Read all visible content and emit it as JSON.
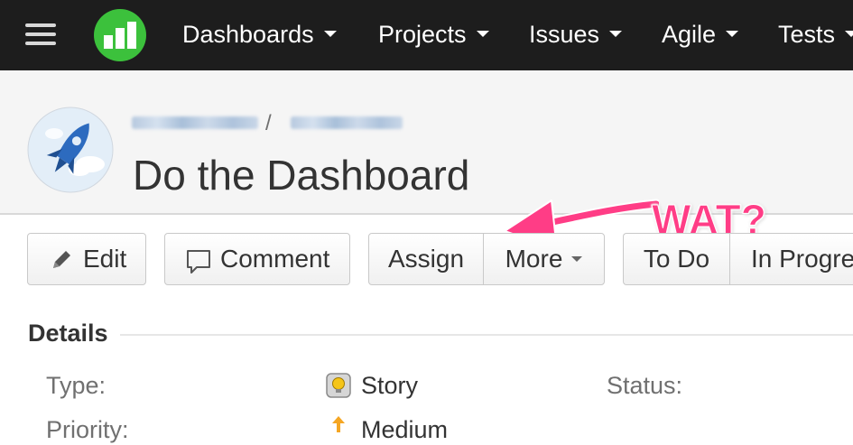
{
  "nav": {
    "items": [
      {
        "label": "Dashboards"
      },
      {
        "label": "Projects"
      },
      {
        "label": "Issues"
      },
      {
        "label": "Agile"
      },
      {
        "label": "Tests"
      }
    ]
  },
  "issue": {
    "title": "Do the Dashboard",
    "breadcrumb_separator": "/"
  },
  "annotation": {
    "text": "WAT?",
    "color": "#ff3d86"
  },
  "toolbar": {
    "edit_label": "Edit",
    "comment_label": "Comment",
    "assign_label": "Assign",
    "more_label": "More",
    "todo_label": "To Do",
    "inprogress_label": "In Progre"
  },
  "details": {
    "heading": "Details",
    "type_label": "Type:",
    "type_value": "Story",
    "priority_label": "Priority:",
    "priority_value": "Medium",
    "status_label": "Status:"
  },
  "colors": {
    "topbar": "#1d1d1d",
    "logo_green": "#3cc13c",
    "header_bg": "#f5f5f5",
    "priority_orange": "#f5a623"
  },
  "icons": {
    "menu": "hamburger-icon",
    "logo": "app-logo-icon",
    "avatar": "rocket-avatar-icon",
    "edit": "pencil-icon",
    "comment": "speech-bubble-icon",
    "type": "story-lightbulb-icon",
    "priority": "arrow-up-icon"
  }
}
